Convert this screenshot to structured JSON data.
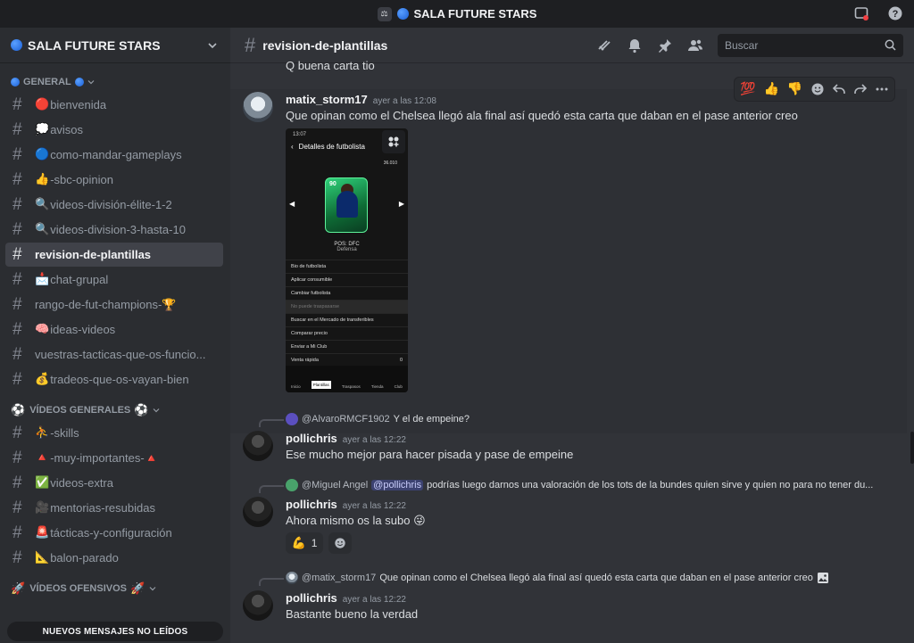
{
  "window": {
    "title": "SALA FUTURE STARS",
    "logo_text": "⚖"
  },
  "sidebar": {
    "server_name": "SALA FUTURE STARS",
    "categories": [
      {
        "label": "GENERAL"
      },
      {
        "label": "VÍDEOS GENERALES"
      },
      {
        "label": "VÍDEOS OFENSIVOS"
      }
    ],
    "channels": [
      {
        "emoji": "🔴",
        "label": "bienvenida"
      },
      {
        "emoji": "💭",
        "label": "avisos"
      },
      {
        "emoji": "🔵",
        "label": "como-mandar-gameplays"
      },
      {
        "emoji": "👍",
        "label": "-sbc-opinion"
      },
      {
        "emoji": "🔍",
        "label": "videos-división-élite-1-2"
      },
      {
        "emoji": "🔍",
        "label": "videos-division-3-hasta-10"
      },
      {
        "emoji": "",
        "label": "revision-de-plantillas"
      },
      {
        "emoji": "📩",
        "label": "chat-grupal"
      },
      {
        "emoji": "",
        "label": "rango-de-fut-champions-🏆"
      },
      {
        "emoji": "🧠",
        "label": "ideas-videos"
      },
      {
        "emoji": "",
        "label": "vuestras-tacticas-que-os-funcio..."
      },
      {
        "emoji": "💰",
        "label": "tradeos-que-os-vayan-bien"
      },
      {
        "emoji": "⛹",
        "label": "-skills"
      },
      {
        "emoji": "🔺",
        "label": "-muy-importantes-🔺"
      },
      {
        "emoji": "✅",
        "label": "videos-extra"
      },
      {
        "emoji": "🎥",
        "label": "mentorias-resubidas"
      },
      {
        "emoji": "🚨",
        "label": "tácticas-y-configuración"
      },
      {
        "emoji": "📐",
        "label": "balon-parado"
      }
    ],
    "unread_banner": "NUEVOS MENSAJES NO LEÍDOS"
  },
  "header": {
    "channel": "revision-de-plantillas",
    "search_placeholder": "Buscar"
  },
  "messages": {
    "prev_text": "Q buena carta tio",
    "msg1": {
      "user": "matix_storm17",
      "time": "ayer a las 12:08",
      "text": "Que opinan como el Chelsea llegó ala final así quedó esta carta que daban en el pase anterior creo"
    },
    "toolbar": [
      "💯",
      "👍",
      "👎"
    ],
    "phone": {
      "time": "13:07",
      "title": "Detalles de futbolista",
      "coins": "36.010",
      "rating": "90",
      "pos": "POS: DFC",
      "sub": "Defensa",
      "menu": [
        "Bio de futbolista",
        "Aplicar consumible",
        "Cambiar futbolista",
        "No puede traspasarse",
        "Buscar en el Mercado de transferibles",
        "Comparar precio",
        "Enviar a Mi Club",
        "Venta rápida"
      ],
      "nav": [
        "Inicio",
        "Plantillas",
        "Traspasos",
        "Tienda",
        "Club"
      ],
      "quick_sell": "0"
    },
    "reply1": {
      "user": "@AlvaroRMCF1902",
      "text": "Y el de empeine?"
    },
    "msg2": {
      "user": "pollichris",
      "time": "ayer a las 12:22",
      "text": "Ese mucho mejor para hacer pisada y pase de empeine"
    },
    "reply2": {
      "user": "@Miguel Angel",
      "mention": "@pollichris",
      "text": "podrías luego darnos una valoración de los tots de la bundes quien sirve y quien no para no tener du..."
    },
    "msg3": {
      "user": "pollichris",
      "time": "ayer a las 12:22",
      "text": "Ahora mismo os la subo 😜"
    },
    "reaction": {
      "emoji": "💪",
      "count": "1"
    },
    "reply3": {
      "user": "@matix_storm17",
      "text": "Que opinan como el Chelsea llegó ala final así quedó esta carta que daban en el pase anterior creo"
    },
    "msg4": {
      "user": "pollichris",
      "time": "ayer a las 12:22",
      "text": "Bastante bueno la verdad"
    }
  }
}
